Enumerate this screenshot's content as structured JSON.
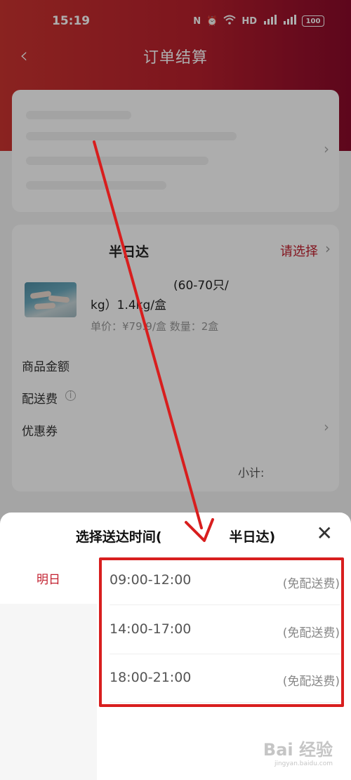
{
  "status_bar": {
    "time": "15:19",
    "icons": [
      "nfc-icon",
      "alarm-icon",
      "wifi-icon",
      "hd-icon",
      "signal-5g-icon",
      "signal-4g-icon"
    ],
    "battery": "100"
  },
  "header": {
    "title": "订单结算",
    "back_icon": "chevron-left-icon"
  },
  "order": {
    "delivery_type": "半日达",
    "choose_label": "请选择",
    "product": {
      "name_line1": "(60-70只/",
      "name_line2": "kg）1.4kg/盒",
      "price_line": "单价：¥79.9/盒  数量：2盒"
    },
    "rows": {
      "goods_amount": "商品金额",
      "delivery_fee": "配送费",
      "coupon": "优惠券"
    },
    "subtotal_label": "小计:"
  },
  "sheet": {
    "title_left": "选择送达时间(",
    "title_right": "半日达)",
    "close_icon": "close-icon",
    "dates": [
      "明日"
    ],
    "slots": [
      {
        "time": "09:00-12:00",
        "fee": "(免配送费)"
      },
      {
        "time": "14:00-17:00",
        "fee": "(免配送费)"
      },
      {
        "time": "18:00-21:00",
        "fee": "(免配送费)"
      }
    ]
  },
  "watermark": {
    "text": "Bai 经验",
    "sub": "jingyan.baidu.com"
  },
  "colors": {
    "accent": "#c21f2e",
    "annotation": "#d81e1e",
    "header_start": "#cc3430",
    "header_end": "#8a0a2a"
  }
}
